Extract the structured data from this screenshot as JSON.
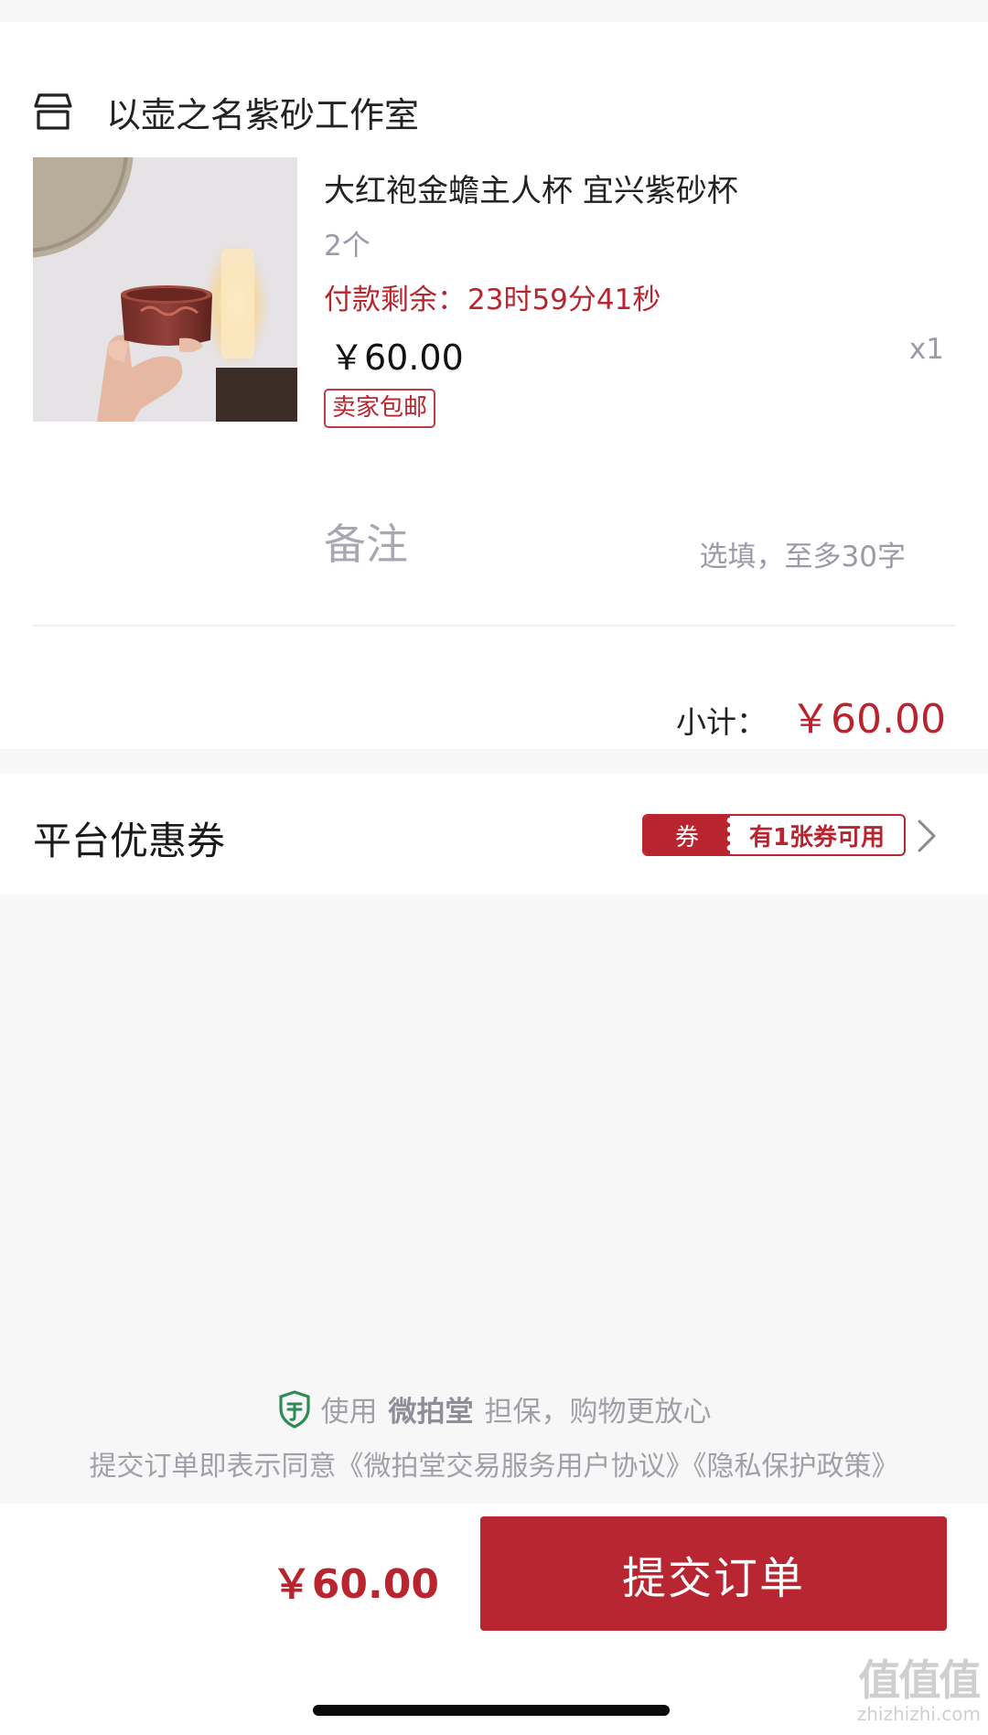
{
  "shop": {
    "icon": "store-icon",
    "name": "以壶之名紫砂工作室"
  },
  "product": {
    "image_icon": "product-photo",
    "title": "大红袍金蟾主人杯 宜兴紫砂杯",
    "spec": "2个",
    "countdown_label": "付款剩余：",
    "countdown_value": "23时59分41秒",
    "price": "￥60.00",
    "quantity": "x1",
    "shipping_tag": "卖家包邮"
  },
  "remark": {
    "label": "备注",
    "value": "",
    "placeholder": "选填，至多30字"
  },
  "subtotal": {
    "label": "小计：",
    "value": "￥60.00"
  },
  "coupon": {
    "title": "平台优惠券",
    "badge_label": "券",
    "badge_text": "有1张券可用",
    "chevron_icon": "chevron-right-icon"
  },
  "guarantee": {
    "icon": "shield-icon",
    "prefix": "使用",
    "brand": "微拍堂",
    "suffix": "担保，购物更放心"
  },
  "agreement": "提交订单即表示同意《微拍堂交易服务用户协议》《隐私保护政策》",
  "footer": {
    "total": "￥60.00",
    "submit_label": "提交订单"
  },
  "watermark": {
    "big": "值值值",
    "small": "zhizhizhi.com"
  },
  "colors": {
    "accent": "#b8252f",
    "muted_text": "#9a9aa8",
    "background": "#f7f7f7"
  }
}
